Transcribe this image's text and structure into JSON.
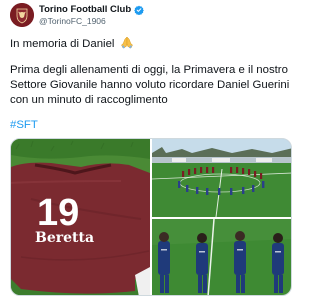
{
  "tweet": {
    "author": {
      "display_name": "Torino Football Club",
      "handle": "@TorinoFC_1906",
      "verified": true,
      "avatar_icon": "torino-bull-crest-icon"
    },
    "text_line1": "In memoria di Daniel",
    "emoji_icon": "folded-hands-icon",
    "text_para2": "Prima degli allenamenti di oggi, la Primavera e il nostro Settore Giovanile hanno voluto ricordare Daniel Guerini con un minuto di raccoglimento",
    "hashtag": "#SFT",
    "media": {
      "jersey_number": "19",
      "jersey_sponsor": "Beretta"
    }
  },
  "colors": {
    "brand": "#7a1c22",
    "link": "#1d9bf0",
    "verified": "#1d9bf0",
    "jersey": "#7b2a30",
    "grass": "#3f8a34"
  }
}
